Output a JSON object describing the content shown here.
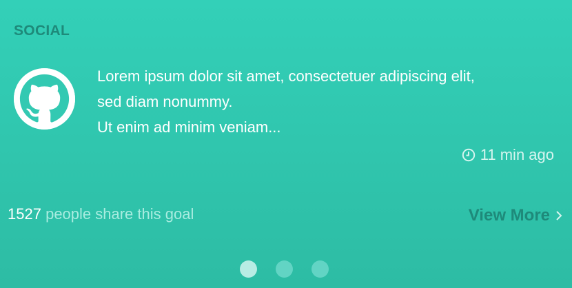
{
  "section": {
    "label": "SOCIAL"
  },
  "post": {
    "avatar_icon": "github-icon",
    "lines": [
      "Lorem ipsum dolor sit amet, consectetuer adipiscing elit,",
      "sed diam nonummy.",
      "Ut enim ad minim veniam..."
    ],
    "time_icon": "clock-icon",
    "time": "11 min ago"
  },
  "footer": {
    "share_count": "1527",
    "share_text": "people share this goal",
    "view_more_label": "View More",
    "view_more_icon": "chevron-right-icon"
  },
  "pagination": {
    "count": 3,
    "active_index": 0
  },
  "colors": {
    "background_top": "#33d0b8",
    "background_bottom": "#2dbca4",
    "accent_dark": "#1e8a7a",
    "white": "#ffffff"
  }
}
